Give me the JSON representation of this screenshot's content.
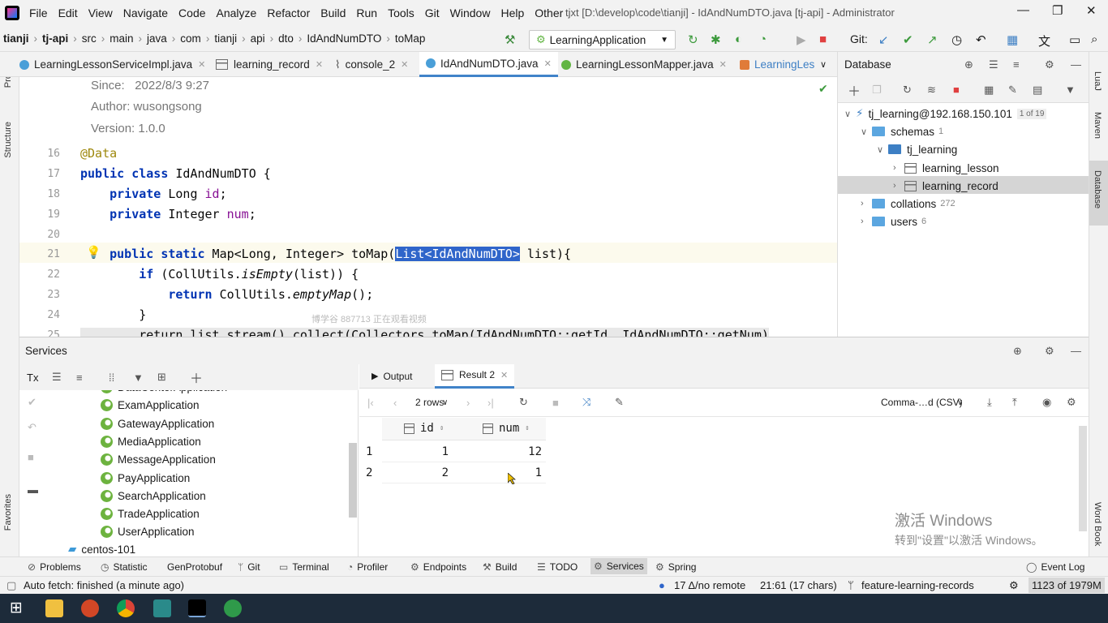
{
  "window": {
    "menu": [
      "File",
      "Edit",
      "View",
      "Navigate",
      "Code",
      "Analyze",
      "Refactor",
      "Build",
      "Run",
      "Tools",
      "Git",
      "Window",
      "Help",
      "Other"
    ],
    "title": "tjxt [D:\\develop\\code\\tianji] - IdAndNumDTO.java [tj-api] - Administrator",
    "controls": {
      "minimize": "—",
      "maximize": "❐",
      "close": "✕"
    }
  },
  "breadcrumb": [
    "tianji",
    "tj-api",
    "src",
    "main",
    "java",
    "com",
    "tianji",
    "api",
    "dto",
    "IdAndNumDTO",
    "toMap"
  ],
  "run_config": "LearningApplication",
  "git_label": "Git:",
  "tabs": [
    {
      "label": "LearningLessonServiceImpl.java",
      "color": "#4a9fd8"
    },
    {
      "label": "learning_record",
      "color": "#777"
    },
    {
      "label": "console_2",
      "color": "#555"
    },
    {
      "label": "IdAndNumDTO.java",
      "color": "#4a9fd8"
    },
    {
      "label": "LearningLessonMapper.java",
      "color": "#62b543"
    },
    {
      "label": "LearningLes",
      "color": "#e07b39"
    }
  ],
  "left_strip": {
    "project": "Project",
    "structure": "Structure",
    "favorites": "Favorites"
  },
  "right_strip": {
    "lua": "LuaJ",
    "maven": "Maven",
    "database": "Database",
    "wordbook": "Word Book"
  },
  "editor": {
    "doc": [
      {
        "key": "Since:",
        "value": "2022/8/3 9:27"
      },
      {
        "key": "Author:",
        "value": "wusongsong"
      },
      {
        "key": "Version:",
        "value": "1.0.0"
      }
    ],
    "line_numbers": [
      "16",
      "17",
      "18",
      "19",
      "20",
      "21",
      "22",
      "23",
      "24",
      "25"
    ],
    "ann": "@Data",
    "l17a": "public class",
    "l17b": " IdAndNumDTO {",
    "l18a": "    private",
    "l18b": " Long ",
    "l18c": "id",
    "l18d": ";",
    "l19a": "    private",
    "l19b": " Integer ",
    "l19c": "num",
    "l19d": ";",
    "l21a": "    public static",
    "l21b": " Map<Long, Integer> toMap(",
    "l21sel": "List<IdAndNumDTO>",
    "l21c": " list){",
    "l22a": "        if",
    "l22b": " (CollUtils.",
    "l22c": "isEmpty",
    "l22d": "(list)) {",
    "l23a": "            return",
    "l23b": " CollUtils.",
    "l23c": "emptyMap",
    "l23d": "();",
    "l24": "        }",
    "l25": "        return list.stream().collect(Collectors.toMap(IdAndNumDTO::getId, IdAndNumDTO::getNum)",
    "watermark": "博学谷 887713 正在观看视频"
  },
  "database": {
    "title": "Database",
    "connection": "tj_learning@192.168.150.101",
    "connection_badge": "1 of 19",
    "schemas": {
      "label": "schemas",
      "count": "1"
    },
    "schema": "tj_learning",
    "tables": [
      "learning_lesson",
      "learning_record"
    ],
    "collations": {
      "label": "collations",
      "count": "272"
    },
    "users": {
      "label": "users",
      "count": "6"
    }
  },
  "services": {
    "title": "Services",
    "tx": "Tx",
    "apps": [
      "DataCenterApplication",
      "ExamApplication",
      "GatewayApplication",
      "MediaApplication",
      "MessageApplication",
      "PayApplication",
      "SearchApplication",
      "TradeApplication",
      "UserApplication"
    ],
    "host": "centos-101",
    "result_tabs": {
      "output": "Output",
      "result": "Result 2"
    },
    "rows_label": "2 rows",
    "export_format": "Comma-…d (CSV)",
    "columns": [
      "id",
      "num"
    ],
    "rows": [
      {
        "n": "1",
        "id": "1",
        "num": "12"
      },
      {
        "n": "2",
        "id": "2",
        "num": "1"
      }
    ]
  },
  "bottom_tools": [
    "Problems",
    "Statistic",
    "GenProtobuf",
    "Git",
    "Terminal",
    "Profiler",
    "Endpoints",
    "Build",
    "TODO",
    "Services",
    "Spring"
  ],
  "event_log": "Event Log",
  "status": {
    "left": "Auto fetch: finished (a minute ago)",
    "remote": "17 Δ/no remote",
    "position": "21:61 (17 chars)",
    "branch": "feature-learning-records",
    "memory": "1123 of 1979M"
  },
  "activate": {
    "line1": "激活 Windows",
    "line2": "转到\"设置\"以激活 Windows。"
  }
}
